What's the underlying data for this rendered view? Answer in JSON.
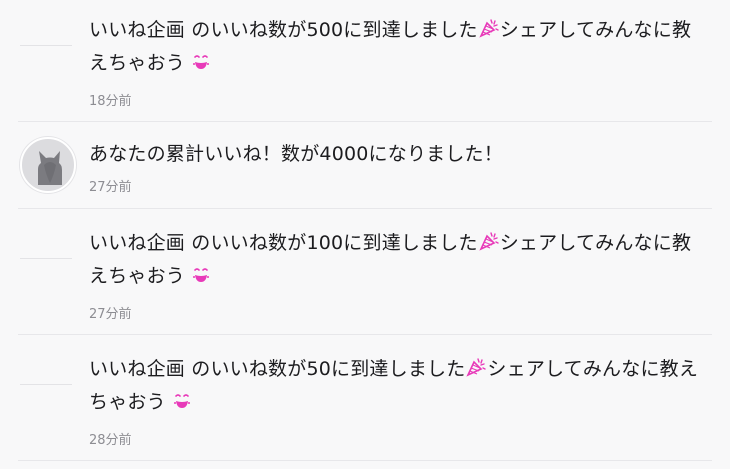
{
  "notifications": [
    {
      "line1": "いいね企画 のいいね数が500に到達しました",
      "line1_after": "シェアしてみんなに教",
      "line2": "えちゃおう",
      "time": "18分前"
    },
    {
      "line1": "あなたの累計いいね！数が4000になりました！",
      "time": "27分前"
    },
    {
      "line1": "いいね企画 のいいね数が100に到達しました",
      "line1_after": "シェアしてみんなに教",
      "line2": "えちゃおう",
      "time": "27分前"
    },
    {
      "line1": "いいね企画 のいいね数が50に到達しました",
      "line1_after": "シェアしてみんなに教え",
      "line2": "ちゃおう",
      "time": "28分前"
    }
  ],
  "icons": {
    "celebrate": "party-popper-icon",
    "smile": "smiling-face-icon",
    "avatar": "cat-silhouette-icon"
  },
  "colors": {
    "emoji_accent": "#e83ab9",
    "time_text": "#8d8d93",
    "message_text": "#1c1c1f"
  }
}
